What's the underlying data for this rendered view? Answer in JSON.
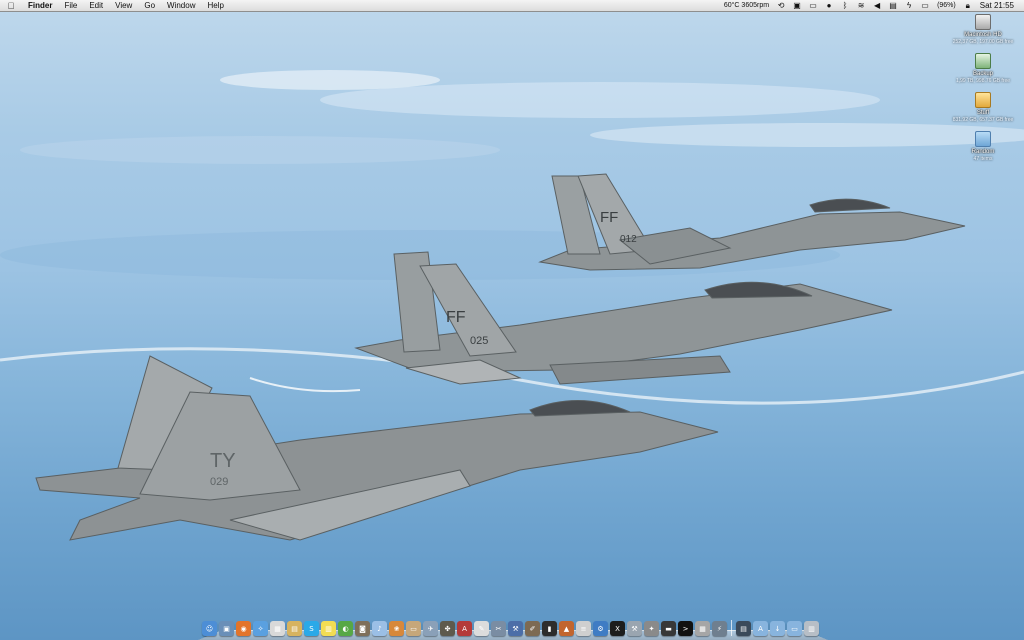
{
  "menubar": {
    "apple_glyph": "",
    "app_name": "Finder",
    "menus": [
      "File",
      "Edit",
      "View",
      "Go",
      "Window",
      "Help"
    ],
    "status": {
      "temperature": "60°C 3605rpm",
      "battery": "(96%)",
      "clock": "Sat 21:55"
    },
    "status_icons": [
      "time-machine-icon",
      "screen-icon",
      "display-icon",
      "user-icon",
      "bluetooth-icon",
      "wifi-icon",
      "volume-icon",
      "flag-icon",
      "power-icon",
      "battery-icon",
      "lock-icon"
    ]
  },
  "desktop": {
    "icons": [
      {
        "name": "Macintosh HD",
        "sub": "252,37 GB, 197.00 GB free",
        "icon": "hard-drive-icon"
      },
      {
        "name": "Backup",
        "sub": "1,99 TB, 998.76 GB free",
        "icon": "backup-drive-icon"
      },
      {
        "name": "Stuff",
        "sub": "831.92 GB, 657.37 GB free",
        "icon": "external-drive-icon"
      },
      {
        "name": "Random",
        "sub": "47 items",
        "icon": "folder-icon"
      }
    ]
  },
  "wallpaper": {
    "aircraft": [
      {
        "tail_code": "TY",
        "serial": "029"
      },
      {
        "tail_code": "FF",
        "serial": "025"
      },
      {
        "tail_code": "FF",
        "serial": "012"
      }
    ]
  },
  "dock": {
    "apps": [
      {
        "name": "finder-icon",
        "color": "#4d8ed6",
        "glyph": "☺"
      },
      {
        "name": "preview-icon",
        "color": "#6a8fb8",
        "glyph": "▣"
      },
      {
        "name": "firefox-icon",
        "color": "#e3742a",
        "glyph": "◉"
      },
      {
        "name": "safari-icon",
        "color": "#5aa0e0",
        "glyph": "✧"
      },
      {
        "name": "calendar-icon",
        "color": "#d9d9d9",
        "glyph": "▦"
      },
      {
        "name": "notes-icon",
        "color": "#d7b35f",
        "glyph": "▤"
      },
      {
        "name": "skype-icon",
        "color": "#2aa9e8",
        "glyph": "S"
      },
      {
        "name": "stickies-icon",
        "color": "#f2dd53",
        "glyph": "▥"
      },
      {
        "name": "colorsync-icon",
        "color": "#57a846",
        "glyph": "◐"
      },
      {
        "name": "photo-icon",
        "color": "#7f6f5a",
        "glyph": "◙"
      },
      {
        "name": "itunes-icon",
        "color": "#9bbfe6",
        "glyph": "♪"
      },
      {
        "name": "iphoto-icon",
        "color": "#d7883a",
        "glyph": "❀"
      },
      {
        "name": "book-icon",
        "color": "#c6a77a",
        "glyph": "▭"
      },
      {
        "name": "bird-icon",
        "color": "#8aa0b8",
        "glyph": "✈"
      },
      {
        "name": "compass-icon",
        "color": "#5e5a4d",
        "glyph": "✤"
      },
      {
        "name": "pdf-icon",
        "color": "#b43a3a",
        "glyph": "A"
      },
      {
        "name": "textedit-icon",
        "color": "#dcdcdc",
        "glyph": "✎"
      },
      {
        "name": "utility-icon",
        "color": "#7a8da3",
        "glyph": "✂"
      },
      {
        "name": "xcode-icon",
        "color": "#4c6ea8",
        "glyph": "⚒"
      },
      {
        "name": "pencil-icon",
        "color": "#7d6a53",
        "glyph": "✐"
      },
      {
        "name": "terminal-window-icon",
        "color": "#2d2d2d",
        "glyph": "▮"
      },
      {
        "name": "presentation-icon",
        "color": "#c2652e",
        "glyph": "▲"
      },
      {
        "name": "script-icon",
        "color": "#cfcfcf",
        "glyph": "≡"
      },
      {
        "name": "xcode-hammer-icon",
        "color": "#3f7cc4",
        "glyph": "⚙"
      },
      {
        "name": "x11-icon",
        "color": "#1d1d1d",
        "glyph": "X"
      },
      {
        "name": "wrench-icon",
        "color": "#9aa5b0",
        "glyph": "⚒"
      },
      {
        "name": "script-editor-icon",
        "color": "#8a8a8a",
        "glyph": "✦"
      },
      {
        "name": "console-icon",
        "color": "#383838",
        "glyph": "▬"
      },
      {
        "name": "terminal-icon",
        "color": "#111111",
        "glyph": ">"
      },
      {
        "name": "calculator-icon",
        "color": "#a6a6a6",
        "glyph": "▦"
      },
      {
        "name": "usb-icon",
        "color": "#6f7f8f",
        "glyph": "⚡"
      }
    ],
    "stacks": [
      {
        "name": "documents-stack-icon",
        "color": "#3b4a5a",
        "glyph": "▤"
      },
      {
        "name": "applications-stack-icon",
        "color": "#88b4de",
        "glyph": "A"
      },
      {
        "name": "downloads-stack-icon",
        "color": "#88b4de",
        "glyph": "↓"
      },
      {
        "name": "folder-stack-icon",
        "color": "#88b4de",
        "glyph": "▭"
      },
      {
        "name": "trash-icon",
        "color": "#b7bec6",
        "glyph": "▥"
      }
    ]
  }
}
